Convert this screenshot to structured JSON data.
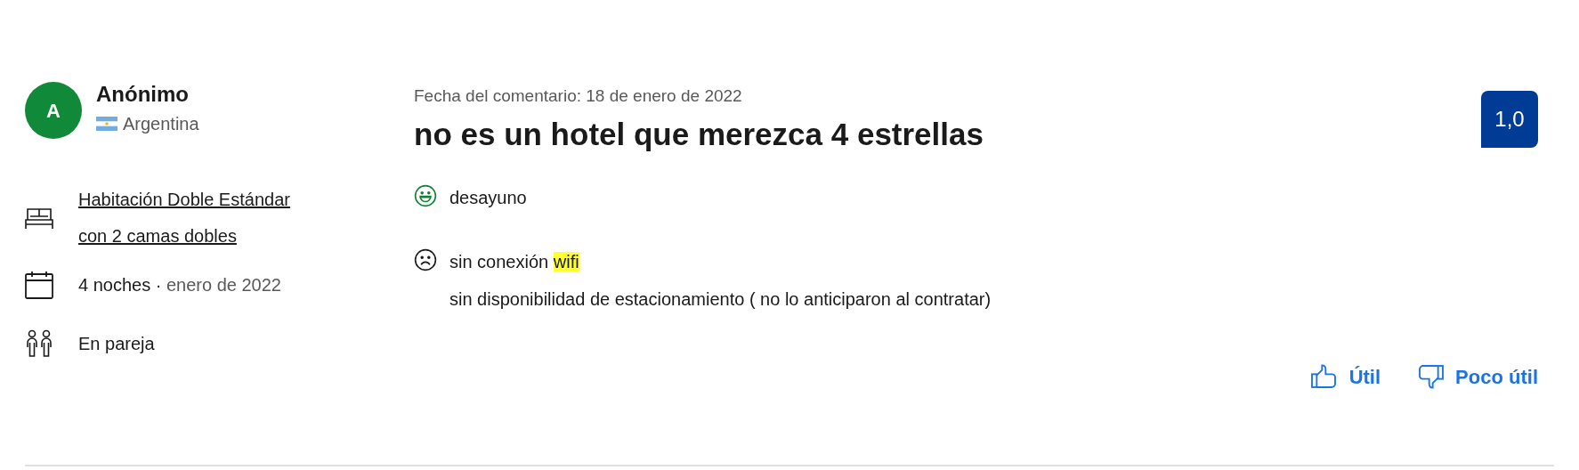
{
  "reviewer": {
    "initial": "A",
    "name": "Anónimo",
    "country": "Argentina"
  },
  "stay": {
    "room": "Habitación Doble Estándar con 2 camas dobles",
    "nights": "4 noches",
    "separator": "·",
    "month": "enero de 2022",
    "traveler_type": "En pareja"
  },
  "review": {
    "date": "Fecha del comentario: 18 de enero de 2022",
    "title": "no es un hotel que merezca 4 estrellas",
    "score": "1,0",
    "comments": [
      {
        "kind": "positive",
        "lines": [
          [
            {
              "text": "desayuno",
              "highlighted": false
            }
          ]
        ]
      },
      {
        "kind": "negative",
        "lines": [
          [
            {
              "text": "sin conexión ",
              "highlighted": false
            },
            {
              "text": "wifi",
              "highlighted": true
            }
          ],
          [
            {
              "text": "sin disponibilidad de estacionamiento ( no lo anticiparon al contratar)",
              "highlighted": false
            }
          ]
        ]
      }
    ]
  },
  "actions": [
    {
      "kind": "helpful",
      "label": "Útil"
    },
    {
      "kind": "unhelpful",
      "label": "Poco útil"
    }
  ]
}
